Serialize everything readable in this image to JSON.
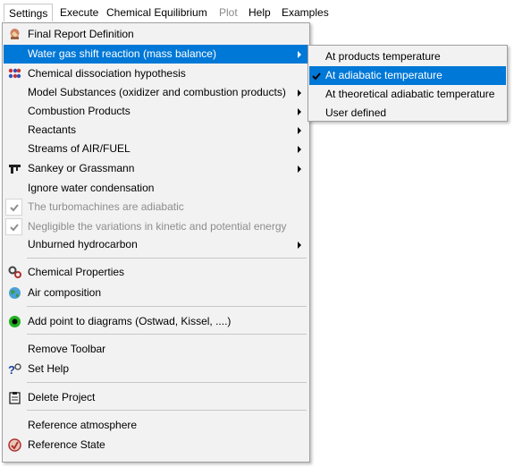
{
  "menubar": {
    "settings": "Settings",
    "execute": "Execute",
    "equilibrium": "Chemical Equilibrium",
    "plot": "Plot",
    "help": "Help",
    "examples": "Examples"
  },
  "menu": {
    "final_report": "Final Report Definition",
    "water_gas": "Water gas shift reaction (mass balance)",
    "dissociation": "Chemical dissociation hypothesis",
    "model_substances": "Model Substances (oxidizer and combustion products)",
    "combustion_products": "Combustion Products",
    "reactants": "Reactants",
    "streams": "Streams of AIR/FUEL",
    "sankey": "Sankey or Grassmann",
    "ignore_water": "Ignore water condensation",
    "turbomachines": "The turbomachines are adiabatic",
    "negligible": "Negligible the variations in kinetic and potential energy",
    "unburned": "Unburned hydrocarbon",
    "chem_properties": "Chemical Properties",
    "air_composition": "Air composition",
    "add_point": "Add point to diagrams (Ostwad, Kissel, ....)",
    "remove_toolbar": "Remove Toolbar",
    "set_help": "Set Help",
    "delete_project": "Delete Project",
    "ref_atmosphere": "Reference atmosphere",
    "ref_state": "Reference State"
  },
  "submenu": {
    "products_temp": "At products temperature",
    "adiabatic_temp": "At adiabatic temperature",
    "theoretical_temp": "At theoretical adiabatic temperature",
    "user_defined": "User defined"
  },
  "colors": {
    "highlight": "#0078d7",
    "menu_bg": "#f2f2f2"
  }
}
